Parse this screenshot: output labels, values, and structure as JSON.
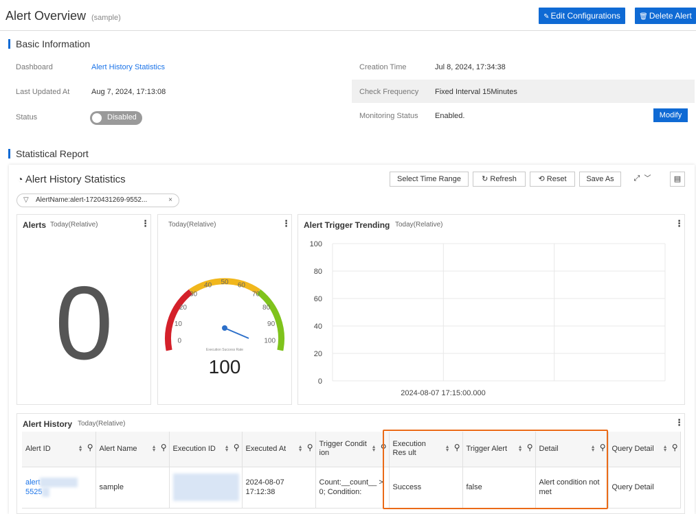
{
  "header": {
    "title": "Alert Overview",
    "subtitle": "(sample)",
    "edit_label": "Edit Configurations",
    "delete_label": "Delete Alert"
  },
  "basic": {
    "section_title": "Basic Information",
    "dashboard_label": "Dashboard",
    "dashboard_value": "Alert History Statistics",
    "last_updated_label": "Last Updated At",
    "last_updated_value": "Aug 7, 2024, 17:13:08",
    "status_label": "Status",
    "status_value": "Disabled",
    "creation_label": "Creation Time",
    "creation_value": "Jul 8, 2024, 17:34:38",
    "frequency_label": "Check Frequency",
    "frequency_value": "Fixed Interval 15Minutes",
    "monitoring_label": "Monitoring Status",
    "monitoring_value": "Enabled.",
    "modify_label": "Modify"
  },
  "report": {
    "section_title": "Statistical Report",
    "dashboard_title": "Alert History Statistics",
    "toolbar": {
      "time_range": "Select Time Range",
      "refresh": "Refresh",
      "reset": "Reset",
      "save_as": "Save As"
    },
    "filter": "AlertName:alert-1720431269-9552..."
  },
  "panels": {
    "alerts": {
      "title": "Alerts",
      "sub": "Today(Relative)",
      "value": "0"
    },
    "gauge": {
      "sub": "Today(Relative)",
      "caption": "Execution Success Rate",
      "value": "100",
      "ticks": [
        "0",
        "10",
        "20",
        "30",
        "40",
        "50",
        "60",
        "70",
        "80",
        "90",
        "100"
      ]
    },
    "trend": {
      "title": "Alert Trigger Trending",
      "sub": "Today(Relative)"
    },
    "history": {
      "title": "Alert History",
      "sub": "Today(Relative)"
    }
  },
  "chart_data": {
    "type": "line",
    "title": "Alert Trigger Trending",
    "x": [
      "2024-08-07 17:15:00.000"
    ],
    "series": [],
    "ylim": [
      0,
      100
    ],
    "yticks": [
      "0",
      "20",
      "40",
      "60",
      "80",
      "100"
    ],
    "xticks": [
      "2024-08-07 17:15:00.000"
    ],
    "grid": true
  },
  "table": {
    "columns": [
      "Alert ID",
      "Alert Name",
      "Execution ID",
      "Executed At",
      "Trigger Condit ion",
      "Execution Res ult",
      "Trigger Alert",
      "Detail",
      "Query Detail"
    ],
    "rows": [
      {
        "alert_id_a": "alert",
        "alert_id_b": "5525",
        "alert_name": "sample",
        "executed_date": "2024-08-07",
        "executed_time": "17:12:38",
        "trigger_a": "Count:__count__ >",
        "trigger_b": "0; Condition:",
        "result": "Success",
        "trigger_alert": "false",
        "detail_a": "Alert condition not",
        "detail_b": "met",
        "query": "Query Detail"
      }
    ]
  }
}
